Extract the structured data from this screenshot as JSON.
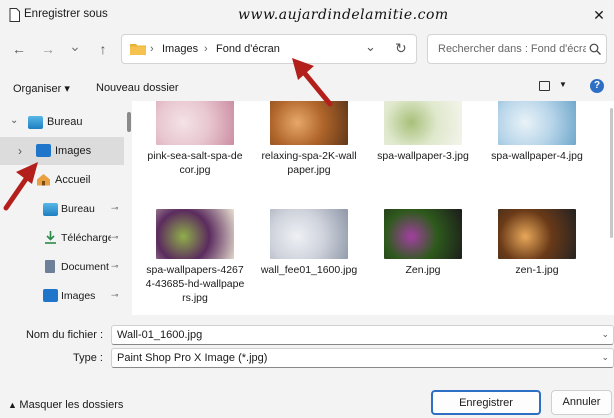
{
  "window": {
    "title": "Enregistrer sous",
    "close_glyph": "✕"
  },
  "watermark": "www.aujardindelamitie.com",
  "nav": {
    "back_glyph": "←",
    "forward_glyph": "→",
    "recent_glyph": "⌄",
    "up_glyph": "↑",
    "breadcrumb": [
      "Images",
      "Fond d'écran"
    ],
    "separator": "›",
    "refresh_glyph": "↻",
    "search_placeholder": "Rechercher dans : Fond d'écran"
  },
  "toolbar": {
    "organiser": "Organiser ▾",
    "new_folder": "Nouveau dossier",
    "help": "?"
  },
  "sidebar": {
    "items": [
      {
        "label": "Bureau",
        "icon": "desktop-folder-icon",
        "chevron": "⌄"
      },
      {
        "label": "Images",
        "icon": "pictures-folder-icon",
        "chevron": "›",
        "selected": true
      },
      {
        "label": "Accueil",
        "icon": "home-icon"
      },
      {
        "label": "Bureau",
        "icon": "desktop-folder-icon",
        "pinned": true
      },
      {
        "label": "Télécharge",
        "icon": "downloads-icon",
        "pinned": true
      },
      {
        "label": "Document",
        "icon": "documents-icon",
        "pinned": true
      },
      {
        "label": "Images",
        "icon": "pictures-folder-icon",
        "pinned": true
      }
    ],
    "pin_glyph": "📌"
  },
  "files": [
    {
      "name": "pink-sea-salt-spa-decor.jpg",
      "colors": [
        "#e8c6cf",
        "#f4e3e6",
        "#c98aa0"
      ]
    },
    {
      "name": "relaxing-spa-2K-wallpaper.jpg",
      "colors": [
        "#b0652a",
        "#e7a86a",
        "#5b3418"
      ]
    },
    {
      "name": "spa-wallpaper-3.jpg",
      "colors": [
        "#dfe8cc",
        "#a8c07a",
        "#f5f5ee"
      ]
    },
    {
      "name": "spa-wallpaper-4.jpg",
      "colors": [
        "#b9d6ea",
        "#e9f2f7",
        "#6aa4c9"
      ]
    },
    {
      "name": "spa-wallpapers-42674-43685-hd-wallpapers.jpg",
      "colors": [
        "#5b2b5e",
        "#8fae4a",
        "#e9e2d0"
      ]
    },
    {
      "name": "wall_fee01_1600.jpg",
      "colors": [
        "#cfd3dc",
        "#eef0f4",
        "#8f98a8"
      ]
    },
    {
      "name": "Zen.jpg",
      "colors": [
        "#2e5a1c",
        "#a23fa0",
        "#1b1b1b"
      ]
    },
    {
      "name": "zen-1.jpg",
      "colors": [
        "#6a3a18",
        "#e8a85a",
        "#222"
      ]
    }
  ],
  "form": {
    "filename_label": "Nom du fichier :",
    "filename_value": "Wall-01_1600.jpg",
    "type_label": "Type :",
    "type_value": "Paint Shop Pro X Image (*.jpg)",
    "dropdown_glyph": "⌄"
  },
  "footer": {
    "hide_folders": "Masquer les dossiers",
    "save": "Enregistrer",
    "cancel": "Annuler"
  },
  "colors": {
    "accent": "#2d6fc4",
    "folder": "#e8b23a",
    "arrow": "#b3201c"
  }
}
